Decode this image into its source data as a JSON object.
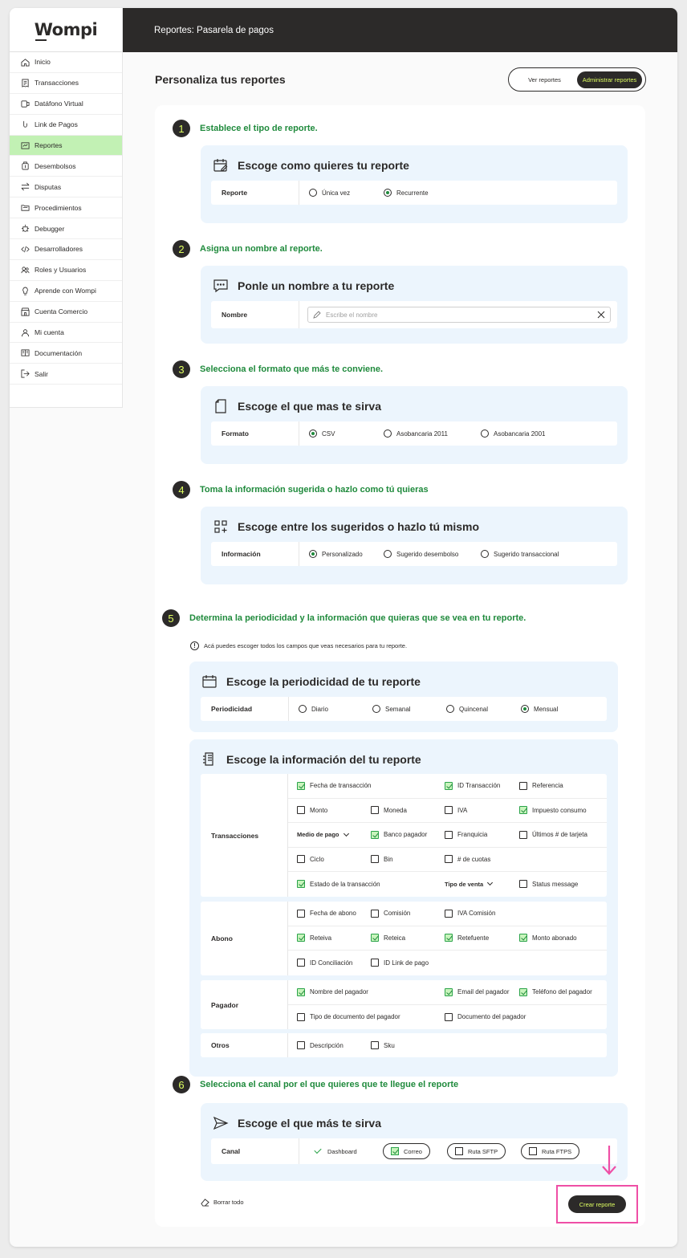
{
  "app": {
    "logo": "Wompi",
    "header_title": "Reportes: Pasarela de pagos"
  },
  "sidebar": {
    "items": [
      {
        "label": "Inicio",
        "icon": "home-icon"
      },
      {
        "label": "Transacciones",
        "icon": "receipt-icon"
      },
      {
        "label": "Datáfono Virtual",
        "icon": "pos-terminal-icon"
      },
      {
        "label": "Link de Pagos",
        "icon": "payment-link-icon"
      },
      {
        "label": "Reportes",
        "icon": "report-icon",
        "active": true
      },
      {
        "label": "Desembolsos",
        "icon": "disbursement-icon"
      },
      {
        "label": "Disputas",
        "icon": "swap-arrows-icon"
      },
      {
        "label": "Procedimientos",
        "icon": "procedures-icon"
      },
      {
        "label": "Debugger",
        "icon": "bug-icon"
      },
      {
        "label": "Desarrolladores",
        "icon": "code-icon"
      },
      {
        "label": "Roles y Usuarios",
        "icon": "users-icon"
      },
      {
        "label": "Aprende con Wompi",
        "icon": "lightbulb-icon"
      },
      {
        "label": "Cuenta Comercio",
        "icon": "store-icon"
      },
      {
        "label": "Mi cuenta",
        "icon": "user-icon"
      },
      {
        "label": "Documentación",
        "icon": "documentation-icon"
      },
      {
        "label": "Salir",
        "icon": "logout-icon"
      }
    ]
  },
  "page": {
    "title": "Personaliza  tus reportes",
    "toggle": {
      "view": "Ver reportes",
      "manage": "Administrar reportes"
    }
  },
  "steps": {
    "s1": {
      "num": "1",
      "title": "Establece el tipo de reporte.",
      "panel_title": "Escoge como quieres tu reporte",
      "row_label": "Reporte",
      "options": [
        {
          "label": "Única vez",
          "selected": false
        },
        {
          "label": "Recurrente",
          "selected": true
        }
      ]
    },
    "s2": {
      "num": "2",
      "title": "Asigna un nombre al reporte.",
      "panel_title": "Ponle un nombre a tu reporte",
      "row_label": "Nombre",
      "placeholder": "Escribe el nombre"
    },
    "s3": {
      "num": "3",
      "title": "Selecciona el formato que más te conviene.",
      "panel_title": "Escoge el que mas te sirva",
      "row_label": "Formato",
      "options": [
        {
          "label": "CSV",
          "selected": true
        },
        {
          "label": "Asobancaria 2011",
          "selected": false
        },
        {
          "label": "Asobancaria 2001",
          "selected": false
        }
      ]
    },
    "s4": {
      "num": "4",
      "title": "Toma la información sugerida o hazlo como tú quieras",
      "panel_title": "Escoge entre los sugeridos o hazlo tú mismo",
      "row_label": "Información",
      "options": [
        {
          "label": "Personalizado",
          "selected": true
        },
        {
          "label": "Sugerido desembolso",
          "selected": false
        },
        {
          "label": "Sugerido transaccional",
          "selected": false
        }
      ]
    },
    "s5": {
      "num": "5",
      "title": "Determina la periodicidad y la  información que quieras que se vea en tu reporte.",
      "info": "Acá puedes escoger todos los campos que veas necesarios para tu reporte.",
      "period_panel_title": "Escoge la periodicidad de tu reporte",
      "period_label": "Periodicidad",
      "period_options": [
        {
          "label": "Diario",
          "selected": false
        },
        {
          "label": "Semanal",
          "selected": false
        },
        {
          "label": "Quincenal",
          "selected": false
        },
        {
          "label": "Mensual",
          "selected": true
        }
      ],
      "info_panel_title": "Escoge la información del tu reporte",
      "groups": {
        "transacciones": {
          "label": "Transacciones"
        },
        "abono": {
          "label": "Abono"
        },
        "pagador": {
          "label": "Pagador"
        },
        "otros": {
          "label": "Otros"
        }
      },
      "fields": {
        "fecha_transaccion": {
          "label": "Fecha de transacción",
          "checked": true
        },
        "id_transaccion": {
          "label": "ID Transacción",
          "checked": true
        },
        "referencia": {
          "label": "Referencia",
          "checked": false
        },
        "monto": {
          "label": "Monto",
          "checked": false
        },
        "moneda": {
          "label": "Moneda",
          "checked": false
        },
        "iva": {
          "label": "IVA",
          "checked": false
        },
        "impuesto_consumo": {
          "label": "Impuesto consumo",
          "checked": true
        },
        "medio_pago": {
          "label": "Medio de pago"
        },
        "banco_pagador": {
          "label": "Banco pagador",
          "checked": true
        },
        "franquicia": {
          "label": "Franquicia",
          "checked": false
        },
        "ultimos_tarjeta": {
          "label": "Últimos # de tarjeta",
          "checked": false
        },
        "ciclo": {
          "label": "Ciclo",
          "checked": false
        },
        "bin": {
          "label": "Bin",
          "checked": false
        },
        "cuotas": {
          "label": "# de cuotas",
          "checked": false
        },
        "estado_transaccion": {
          "label": "Estado de la transacción",
          "checked": true
        },
        "tipo_venta": {
          "label": "Tipo de venta"
        },
        "status_message": {
          "label": "Status message",
          "checked": false
        },
        "fecha_abono": {
          "label": "Fecha de abono",
          "checked": false
        },
        "comision": {
          "label": "Comisión",
          "checked": false
        },
        "iva_comision": {
          "label": "IVA Comisión",
          "checked": false
        },
        "reteiva": {
          "label": "Reteiva",
          "checked": true
        },
        "reteica": {
          "label": "Reteica",
          "checked": true
        },
        "retefuente": {
          "label": "Retefuente",
          "checked": true
        },
        "monto_abonado": {
          "label": "Monto abonado",
          "checked": true
        },
        "id_conciliacion": {
          "label": "ID Conciliación",
          "checked": false
        },
        "id_link_pago": {
          "label": "ID Link de pago",
          "checked": false
        },
        "nombre_pagador": {
          "label": "Nombre del pagador",
          "checked": true
        },
        "email_pagador": {
          "label": "Email del pagador",
          "checked": true
        },
        "telefono_pagador": {
          "label": "Teléfono del pagador",
          "checked": true
        },
        "tipo_documento": {
          "label": "Tipo de documento del pagador",
          "checked": false
        },
        "documento_pagador": {
          "label": "Documento del pagador",
          "checked": false
        },
        "descripcion": {
          "label": "Descripción",
          "checked": false
        },
        "sku": {
          "label": "Sku",
          "checked": false
        }
      }
    },
    "s6": {
      "num": "6",
      "title": "Selecciona el canal por el que quieres que te llegue el reporte",
      "panel_title": "Escoge el que más te sirva",
      "row_label": "Canal",
      "dashboard": "Dashboard",
      "correo": "Correo",
      "sftp": "Ruta SFTP",
      "ftps": "Ruta FTPS"
    }
  },
  "actions": {
    "clear_all": "Borrar todo",
    "create": "Crear reporte"
  },
  "colors": {
    "dark": "#2c2a29",
    "accent_lime": "#dfff61",
    "green_text": "#1f8a3c",
    "panel_blue": "#ecf5fd",
    "active_nav": "#c2f1b4",
    "highlight_pink": "#ef4fa6"
  }
}
